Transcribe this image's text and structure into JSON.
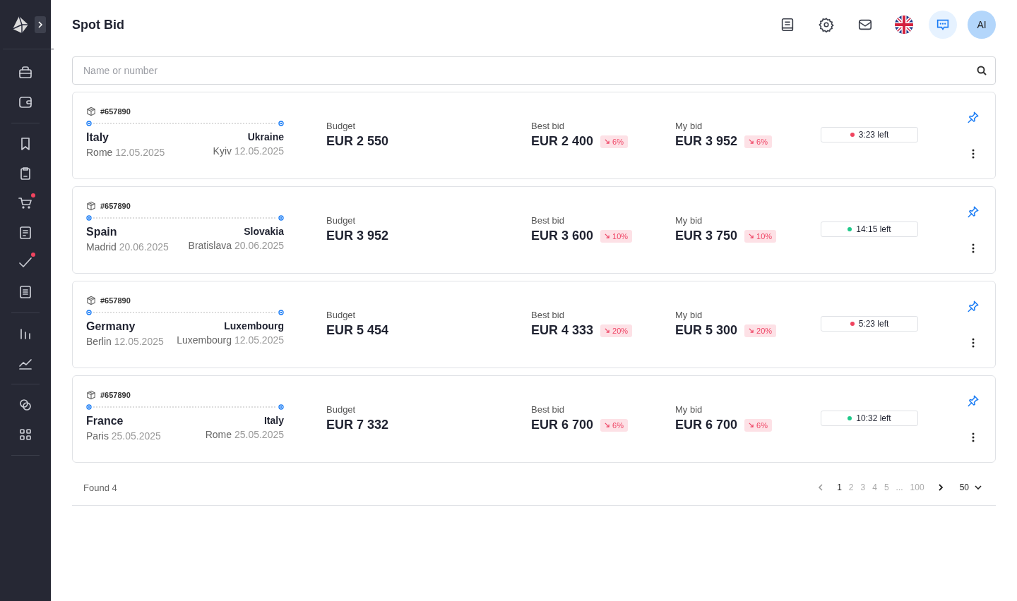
{
  "sidebar": {
    "items": [
      {
        "dot": false
      },
      {
        "dot": false
      },
      {
        "dot": false
      },
      {
        "dot": false
      },
      {
        "dot": true
      },
      {
        "dot": false
      },
      {
        "dot": true
      },
      {
        "dot": false
      },
      {
        "dot": false
      },
      {
        "dot": false
      },
      {
        "dot": false
      },
      {
        "dot": false
      }
    ]
  },
  "header": {
    "title": "Spot Bid",
    "avatar": "AI"
  },
  "search": {
    "placeholder": "Name or number"
  },
  "orders": [
    {
      "number": "#657890",
      "from_country": "Italy",
      "from_city": "Rome",
      "from_date": "12.05.2025",
      "to_country": "Ukraine",
      "to_city": "Kyiv",
      "to_date": "12.05.2025",
      "budget_label": "Budget",
      "budget": "EUR 2 550",
      "best_label": "Best bid",
      "best": "EUR 2 400",
      "best_change": "6%",
      "my_label": "My bid",
      "my": "EUR 3 952",
      "my_change": "6%",
      "timer": "3:23 left",
      "color": "#f0445f"
    },
    {
      "number": "#657890",
      "from_country": "Spain",
      "from_city": "Madrid",
      "from_date": "20.06.2025",
      "to_country": "Slovakia",
      "to_city": "Bratislava",
      "to_date": "20.06.2025",
      "budget_label": "Budget",
      "budget": "EUR 3 952",
      "best_label": "Best bid",
      "best": "EUR 3 600",
      "best_change": "10%",
      "my_label": "My bid",
      "my": "EUR 3 750",
      "my_change": "10%",
      "timer": "14:15 left",
      "color": "#1fc98a"
    },
    {
      "number": "#657890",
      "from_country": "Germany",
      "from_city": "Berlin",
      "from_date": "12.05.2025",
      "to_country": "Luxembourg",
      "to_city": "Luxembourg",
      "to_date": "12.05.2025",
      "budget_label": "Budget",
      "budget": "EUR 5 454",
      "best_label": "Best bid",
      "best": "EUR 4 333",
      "best_change": "20%",
      "my_label": "My bid",
      "my": "EUR 5 300",
      "my_change": "20%",
      "timer": "5:23 left",
      "color": "#f0445f"
    },
    {
      "number": "#657890",
      "from_country": "France",
      "from_city": "Paris",
      "from_date": "25.05.2025",
      "to_country": "Italy",
      "to_city": "Rome",
      "to_date": "25.05.2025",
      "budget_label": "Budget",
      "budget": "EUR 7 332",
      "best_label": "Best bid",
      "best": "EUR 6 700",
      "best_change": "6%",
      "my_label": "My bid",
      "my": "EUR 6 700",
      "my_change": "6%",
      "timer": "10:32 left",
      "color": "#1fc98a"
    }
  ],
  "footer": {
    "found": "Found 4",
    "pages": [
      {
        "label": "1",
        "selected": true
      },
      {
        "label": "2",
        "selected": false
      },
      {
        "label": "3",
        "selected": false
      },
      {
        "label": "4",
        "selected": false
      },
      {
        "label": "5",
        "selected": false
      },
      {
        "label": "...",
        "selected": false
      },
      {
        "label": "100",
        "selected": false
      }
    ],
    "page_size": "50"
  }
}
